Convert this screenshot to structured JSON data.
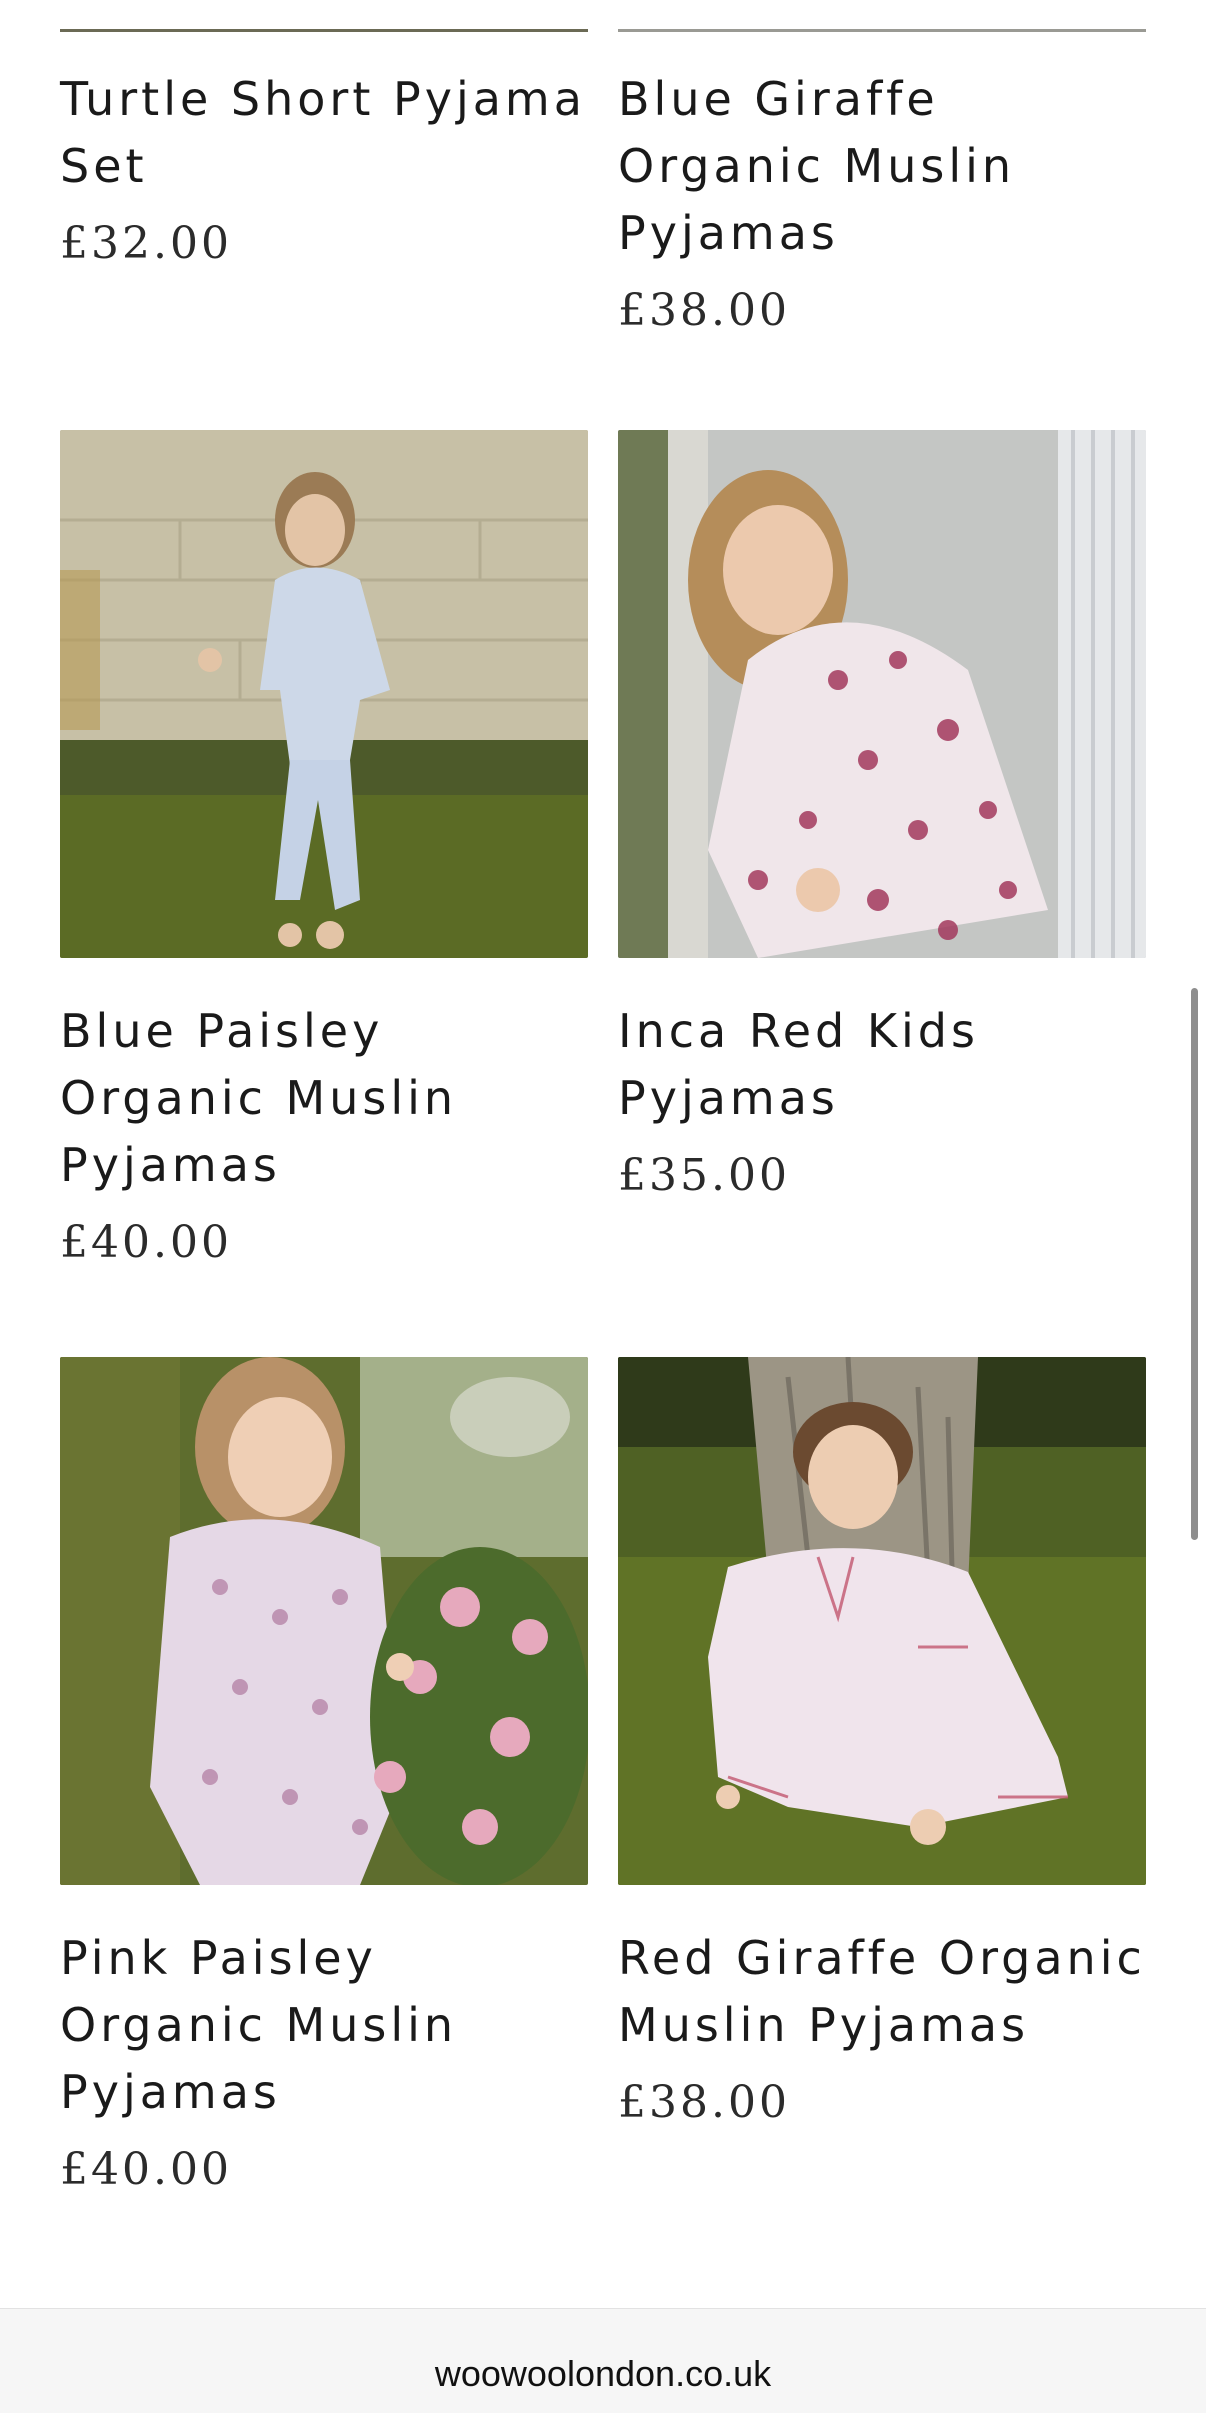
{
  "products": [
    {
      "title": "Turtle Short Pyjama Set",
      "price": "£32.00"
    },
    {
      "title": "Blue Giraffe Organic Muslin Pyjamas",
      "price": "£38.00"
    },
    {
      "title": "Blue Paisley Organic Muslin Pyjamas",
      "price": "£40.00",
      "image": "girl-running-blue-paisley-pyjamas"
    },
    {
      "title": "Inca Red Kids Pyjamas",
      "price": "£35.00",
      "image": "girl-sitting-by-window-red-pyjamas"
    },
    {
      "title": "Pink Paisley Organic Muslin Pyjamas",
      "price": "£40.00",
      "image": "girl-by-roses-pink-pyjamas"
    },
    {
      "title": "Red Giraffe Organic Muslin Pyjamas",
      "price": "£38.00",
      "image": "boy-under-tree-red-pyjamas"
    }
  ],
  "footer": {
    "url": "woowoolondon.co.uk"
  }
}
